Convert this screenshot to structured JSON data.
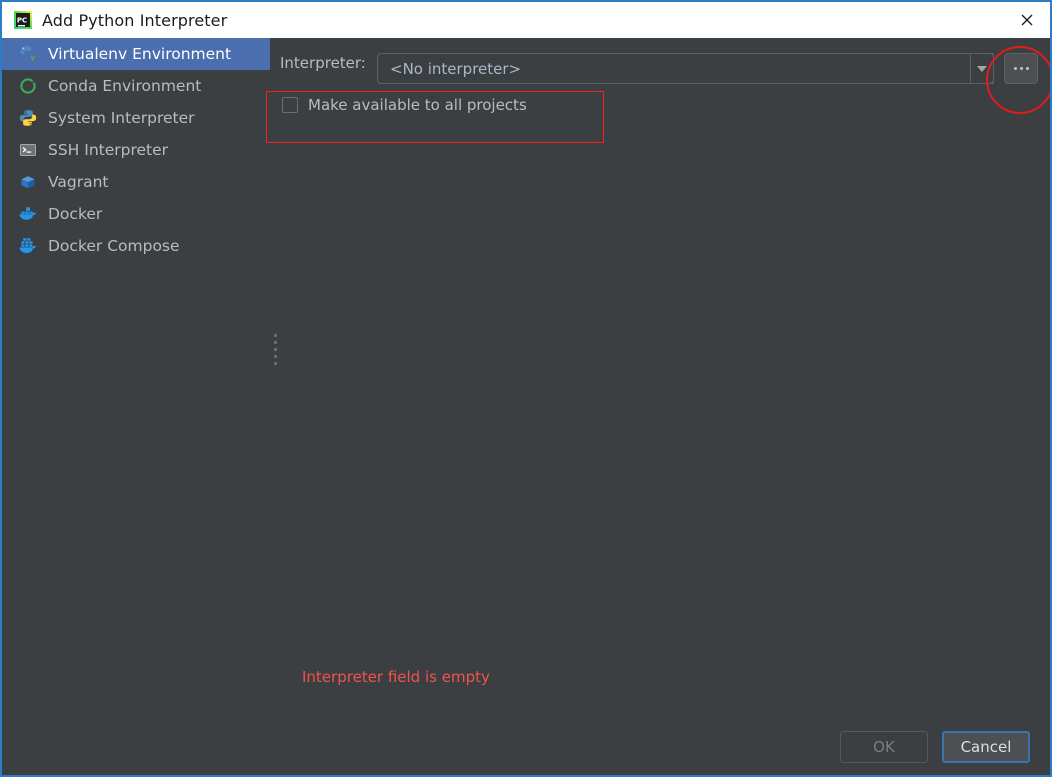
{
  "window": {
    "title": "Add Python Interpreter",
    "app_icon": "pycharm-icon",
    "close_icon": "close-icon",
    "accent_border": "#2e7dc4",
    "background": "#3c3f41"
  },
  "sidebar": {
    "selected_index": 0,
    "selection_color": "#4b6eaf",
    "items": [
      {
        "label": "Virtualenv Environment",
        "icon": "virtualenv-icon"
      },
      {
        "label": "Conda Environment",
        "icon": "conda-icon"
      },
      {
        "label": "System Interpreter",
        "icon": "python-icon"
      },
      {
        "label": "SSH Interpreter",
        "icon": "terminal-icon"
      },
      {
        "label": "Vagrant",
        "icon": "vagrant-icon"
      },
      {
        "label": "Docker",
        "icon": "docker-icon"
      },
      {
        "label": "Docker Compose",
        "icon": "docker-compose-icon"
      }
    ]
  },
  "main": {
    "interpreter": {
      "label": "Interpreter:",
      "value": "<No interpreter>",
      "placeholder": "<No interpreter>",
      "dropdown_icon": "chevron-down-icon",
      "browse_label": "...",
      "browse_icon": "ellipsis-icon"
    },
    "make_available": {
      "label": "Make available to all projects",
      "checked": false
    },
    "splitter_icon": "splitter-grip-icon"
  },
  "annotations": {
    "color": "#ee2222",
    "rect_target": "make-available-checkbox-row",
    "ellipse_target": "browse-button"
  },
  "validation": {
    "message": "Interpreter field is empty",
    "color": "#f1534c"
  },
  "footer": {
    "ok_label": "OK",
    "ok_enabled": false,
    "cancel_label": "Cancel",
    "cancel_focused": true
  }
}
